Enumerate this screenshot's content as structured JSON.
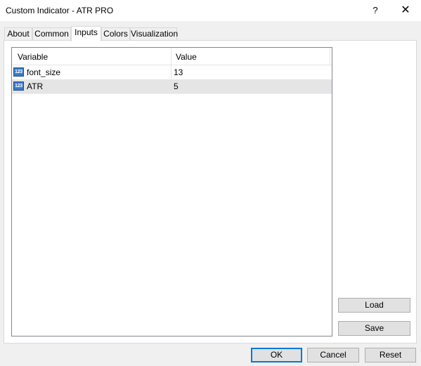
{
  "window": {
    "title": "Custom Indicator - ATR PRO",
    "help_label": "?",
    "close_label": "✕"
  },
  "tabs": [
    {
      "label": "About"
    },
    {
      "label": "Common"
    },
    {
      "label": "Inputs"
    },
    {
      "label": "Colors"
    },
    {
      "label": "Visualization"
    }
  ],
  "table": {
    "headers": [
      "Variable",
      "Value"
    ],
    "rows": [
      {
        "icon": "123",
        "variable": "font_size",
        "value": "13"
      },
      {
        "icon": "123",
        "variable": "ATR",
        "value": "5"
      }
    ]
  },
  "side_buttons": {
    "load": "Load",
    "save": "Save"
  },
  "footer_buttons": {
    "ok": "OK",
    "cancel": "Cancel",
    "reset": "Reset"
  }
}
